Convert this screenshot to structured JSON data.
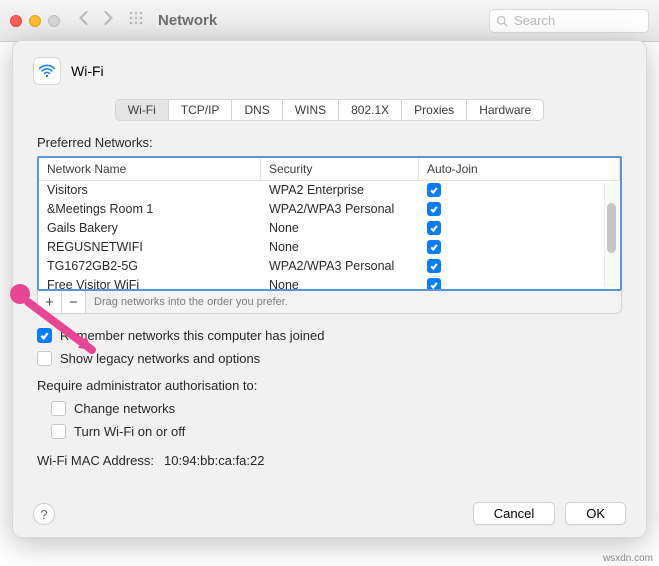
{
  "titlebar": {
    "title": "Network",
    "search_placeholder": "Search"
  },
  "sheet": {
    "title": "Wi-Fi",
    "tabs": [
      "Wi-Fi",
      "TCP/IP",
      "DNS",
      "WINS",
      "802.1X",
      "Proxies",
      "Hardware"
    ],
    "active_tab": 0,
    "preferred_label": "Preferred Networks:",
    "columns": {
      "name": "Network Name",
      "security": "Security",
      "autojoin": "Auto-Join"
    },
    "networks": [
      {
        "name": "Visitors",
        "security": "WPA2 Enterprise",
        "autojoin": true
      },
      {
        "name": "&Meetings Room 1",
        "security": "WPA2/WPA3 Personal",
        "autojoin": true
      },
      {
        "name": "Gails Bakery",
        "security": "None",
        "autojoin": true
      },
      {
        "name": "REGUSNETWIFI",
        "security": "None",
        "autojoin": true
      },
      {
        "name": "TG1672GB2-5G",
        "security": "WPA2/WPA3 Personal",
        "autojoin": true
      },
      {
        "name": "Free Visitor WiFi",
        "security": "None",
        "autojoin": true
      }
    ],
    "drag_hint": "Drag networks into the order you prefer.",
    "remember_label": "Remember networks this computer has joined",
    "remember_checked": true,
    "legacy_label": "Show legacy networks and options",
    "legacy_checked": false,
    "require_label": "Require administrator authorisation to:",
    "change_nets_label": "Change networks",
    "turn_wifi_label": "Turn Wi-Fi on or off",
    "mac_label": "Wi-Fi MAC Address:",
    "mac_value": "10:94:bb:ca:fa:22",
    "cancel": "Cancel",
    "ok": "OK"
  },
  "watermark": "wsxdn.com"
}
